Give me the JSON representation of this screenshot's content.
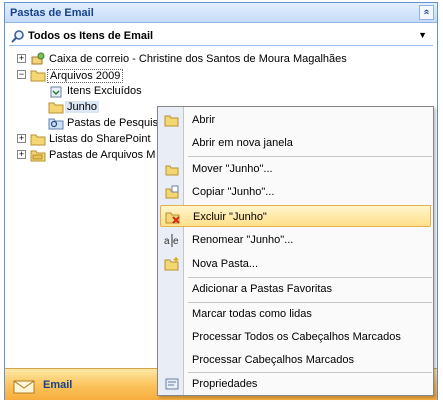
{
  "pane": {
    "header_title": "Pastas de Email",
    "collapse_glyph": "»",
    "view_label": "Todos os Itens de Email",
    "view_dropdown_glyph": "▼"
  },
  "tree": [
    {
      "label": "Caixa de correio - Christine dos Santos de Moura Magalhães",
      "expander": "+",
      "icon": "mailbox-icon"
    },
    {
      "label": "Arquivos 2009",
      "expander": "−",
      "icon": "folder-icon"
    },
    {
      "label": "Itens Excluídos",
      "icon": "deleted-items-icon"
    },
    {
      "label": "Junho",
      "icon": "folder-icon"
    },
    {
      "label": "Pastas de Pesquis",
      "icon": "search-folders-icon"
    },
    {
      "label": "Listas do SharePoint",
      "expander": "+",
      "icon": "sharepoint-icon"
    },
    {
      "label": "Pastas de Arquivos M",
      "expander": "+",
      "icon": "archive-folders-icon"
    }
  ],
  "nav": {
    "email_label": "Email"
  },
  "menu": [
    {
      "label": "Abrir",
      "icon": "open-folder-icon"
    },
    {
      "label": "Abrir em nova janela"
    },
    {
      "label": "Mover \"Junho\"...",
      "icon": "move-icon"
    },
    {
      "label": "Copiar \"Junho\"...",
      "icon": "copy-icon"
    },
    {
      "label": "Excluir \"Junho\"",
      "icon": "delete-folder-icon",
      "active": true
    },
    {
      "label": "Renomear \"Junho\"...",
      "icon": "rename-icon"
    },
    {
      "label": "Nova Pasta...",
      "icon": "new-folder-icon"
    },
    {
      "label": "Adicionar a Pastas Favoritas"
    },
    {
      "label": "Marcar todas como lidas"
    },
    {
      "label": "Processar Todos os Cabeçalhos Marcados"
    },
    {
      "label": "Processar Cabeçalhos Marcados"
    },
    {
      "label": "Propriedades",
      "icon": "properties-icon"
    }
  ],
  "colors": {
    "header_text": "#15428b",
    "active_item": "#ffdf8a",
    "nav_bar": "#fbc25a"
  }
}
